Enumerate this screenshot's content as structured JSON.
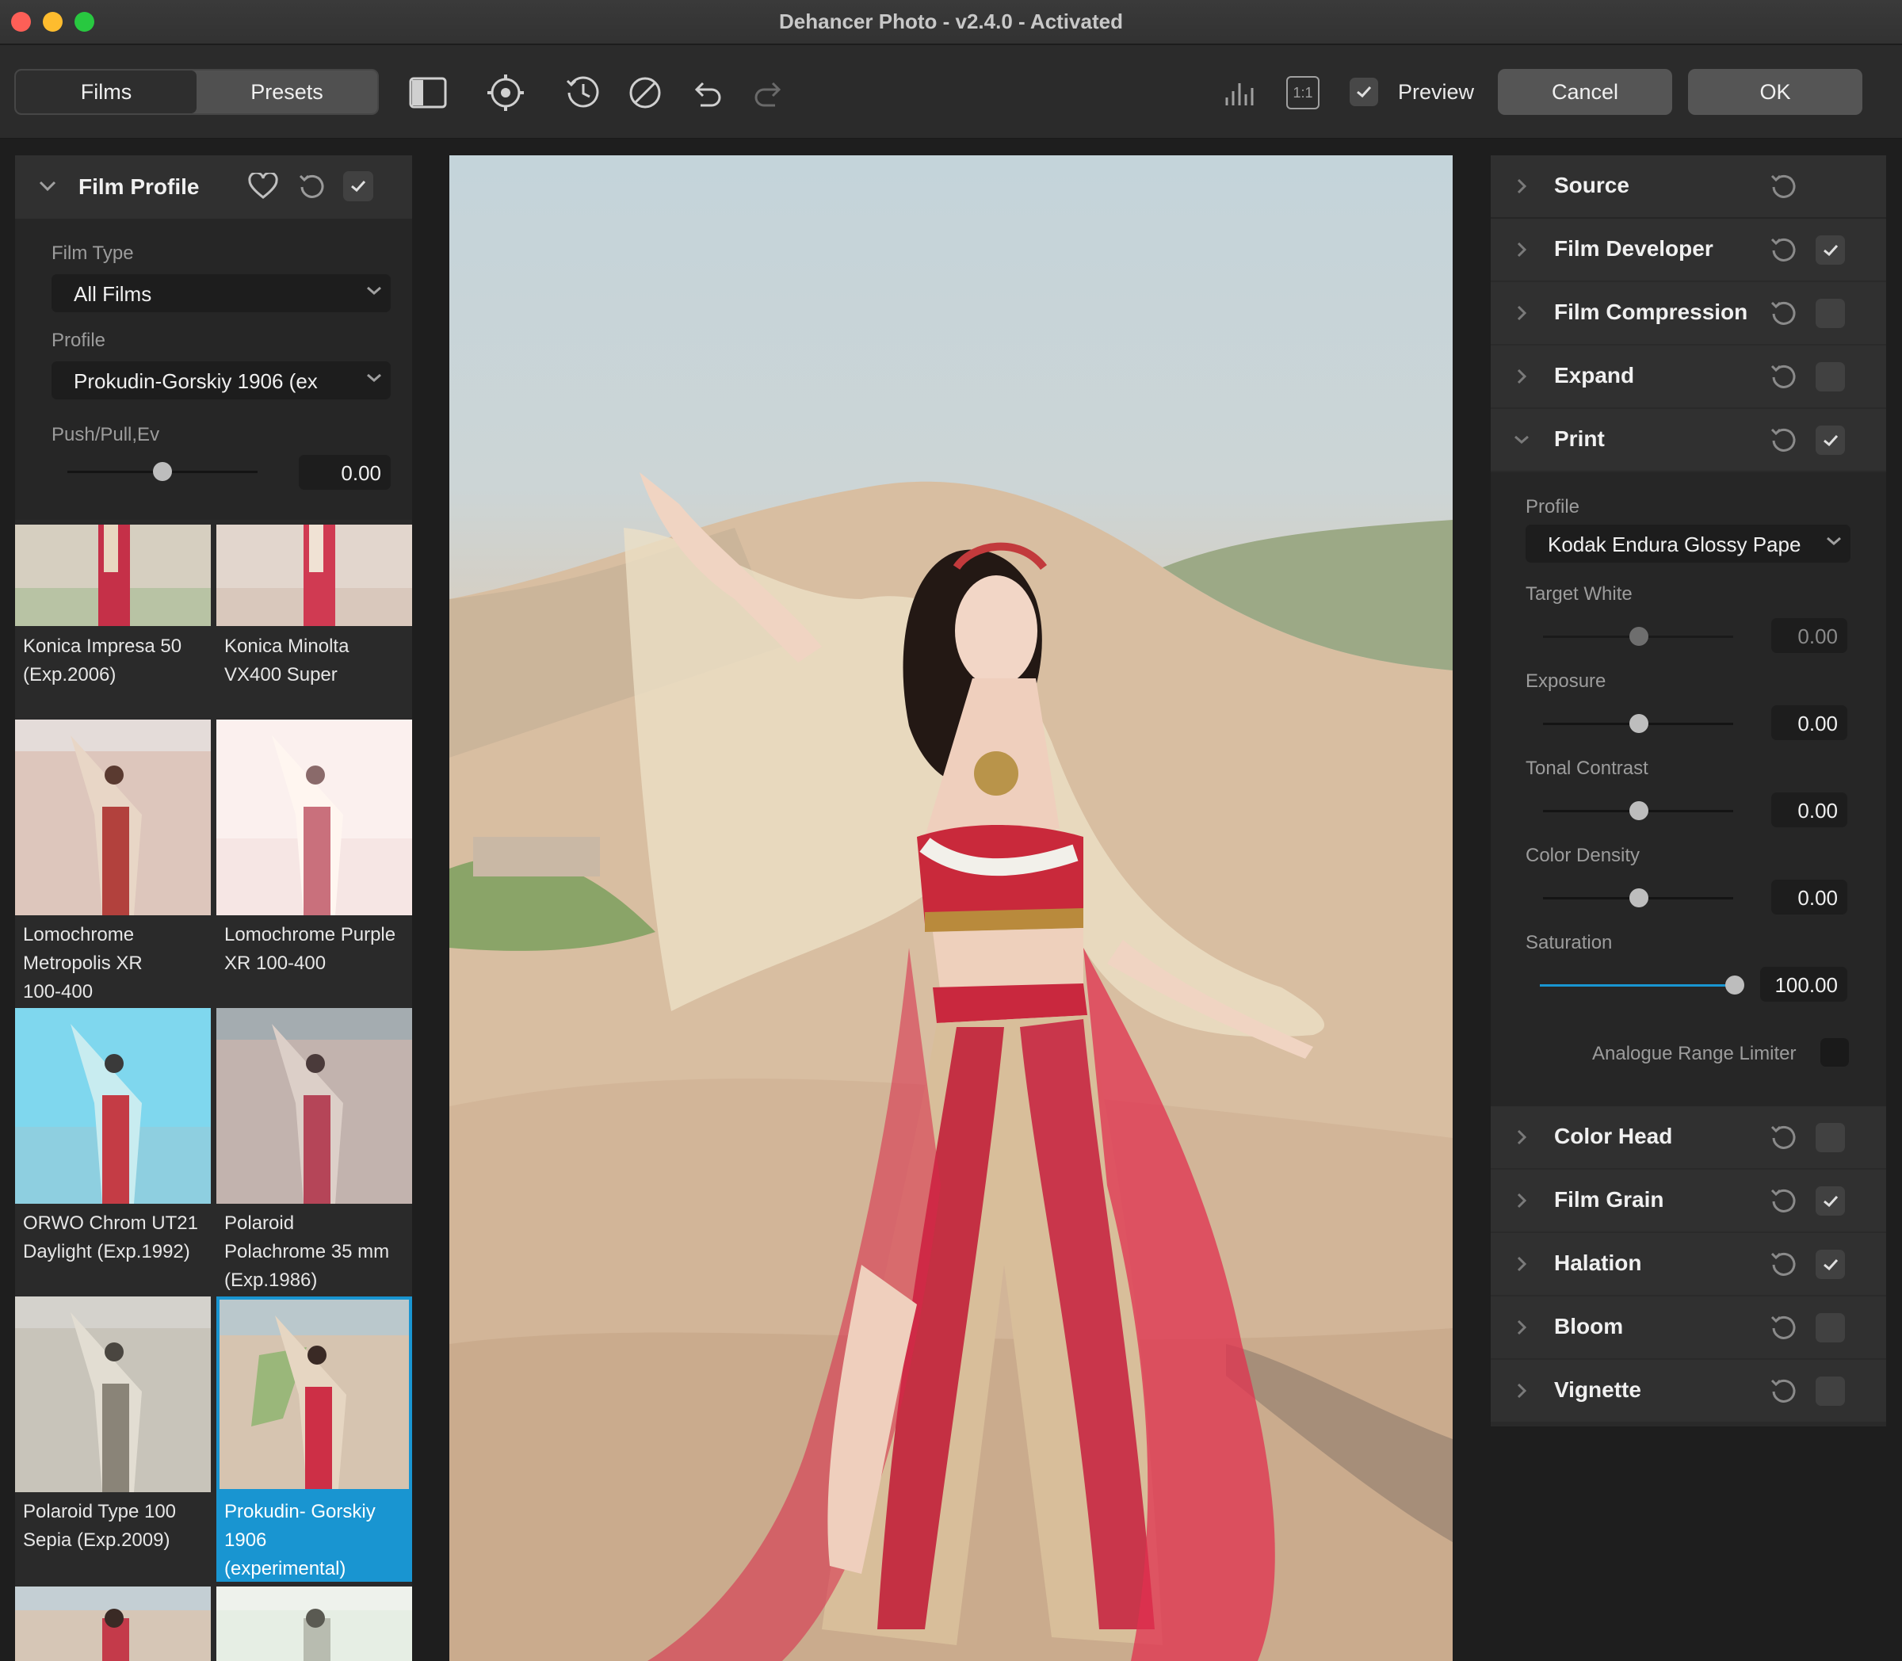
{
  "window": {
    "title": "Dehancer Photo - v2.4.0 - Activated"
  },
  "toolbar": {
    "tabs": [
      {
        "label": "Films",
        "active": true
      },
      {
        "label": "Presets",
        "active": false
      }
    ],
    "icons": [
      "sidebar-toggle-icon",
      "settings-icon",
      "history-icon",
      "disable-icon",
      "undo-icon",
      "redo-icon",
      "histogram-icon",
      "zoom-1to1-icon"
    ],
    "zoom_label": "1:1",
    "preview_label": "Preview",
    "preview_checked": true,
    "cancel_label": "Cancel",
    "ok_label": "OK"
  },
  "film_profile": {
    "title": "Film Profile",
    "film_type_label": "Film Type",
    "film_type_value": "All Films",
    "profile_label": "Profile",
    "profile_value": "Prokudin-Gorskiy 1906 (ex",
    "push_pull_label": "Push/Pull,Ev",
    "push_pull_value": "0.00",
    "films": [
      {
        "line1": "Konica Impresa 50",
        "line2": "(Exp.2006)",
        "line3": ""
      },
      {
        "line1": "Konica Minolta",
        "line2": "VX400 Super",
        "line3": ""
      },
      {
        "line1": "Lomochrome",
        "line2": "Metropolis XR",
        "line3": "100-400"
      },
      {
        "line1": "Lomochrome Purple",
        "line2": "XR 100-400",
        "line3": ""
      },
      {
        "line1": "ORWO Chrom UT21",
        "line2": "Daylight (Exp.1992)",
        "line3": ""
      },
      {
        "line1": "Polaroid",
        "line2": "Polachrome 35 mm",
        "line3": "(Exp.1986)"
      },
      {
        "line1": "Polaroid Type 100",
        "line2": "Sepia (Exp.2009)",
        "line3": ""
      },
      {
        "line1": "Prokudin- Gorskiy",
        "line2": "1906",
        "line3": "(experimental)",
        "selected": true
      }
    ]
  },
  "modules": [
    {
      "label": "Source",
      "expanded": false,
      "has_check": false,
      "checked": false
    },
    {
      "label": "Film Developer",
      "expanded": false,
      "has_check": true,
      "checked": true
    },
    {
      "label": "Film Compression",
      "expanded": false,
      "has_check": true,
      "checked": false
    },
    {
      "label": "Expand",
      "expanded": false,
      "has_check": true,
      "checked": false
    },
    {
      "label": "Print",
      "expanded": true,
      "has_check": true,
      "checked": true
    },
    {
      "label": "Color Head",
      "expanded": false,
      "has_check": true,
      "checked": false
    },
    {
      "label": "Film Grain",
      "expanded": false,
      "has_check": true,
      "checked": true
    },
    {
      "label": "Halation",
      "expanded": false,
      "has_check": true,
      "checked": true
    },
    {
      "label": "Bloom",
      "expanded": false,
      "has_check": true,
      "checked": false
    },
    {
      "label": "Vignette",
      "expanded": false,
      "has_check": true,
      "checked": false
    }
  ],
  "print": {
    "profile_label": "Profile",
    "profile_value": "Kodak Endura Glossy Pape",
    "sliders": [
      {
        "label": "Target White",
        "value": "0.00",
        "position": 0.5,
        "dim": true
      },
      {
        "label": "Exposure",
        "value": "0.00",
        "position": 0.5
      },
      {
        "label": "Tonal Contrast",
        "value": "0.00",
        "position": 0.5
      },
      {
        "label": "Color Density",
        "value": "0.00",
        "position": 0.5
      },
      {
        "label": "Saturation",
        "value": "100.00",
        "position": 1.0,
        "active": true
      }
    ],
    "analogue_label": "Analogue Range Limiter",
    "analogue_checked": false
  },
  "colors": {
    "accent": "#1995d1",
    "panel": "#2a2a2a",
    "header": "#303030"
  }
}
